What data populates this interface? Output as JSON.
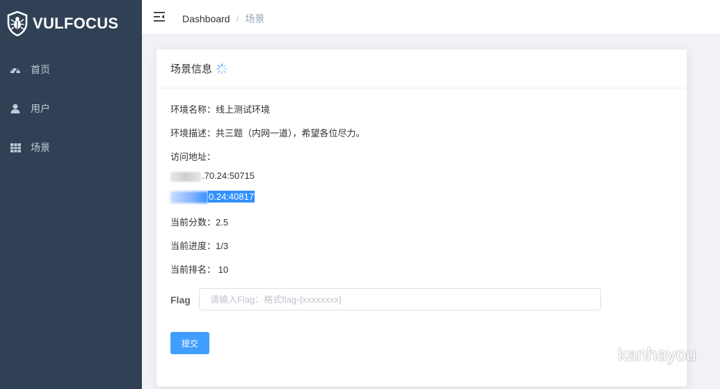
{
  "app": {
    "brand": "VULFOCUS"
  },
  "sidebar": {
    "items": [
      {
        "label": "首页",
        "icon": "dashboard-icon"
      },
      {
        "label": "用户",
        "icon": "user-icon"
      },
      {
        "label": "场景",
        "icon": "table-icon"
      }
    ]
  },
  "navbar": {
    "breadcrumb": [
      "Dashboard",
      "场景"
    ]
  },
  "card": {
    "title": "场景信息",
    "env_name": "环境名称：线上测试环境",
    "env_desc": "环境描述：共三题（内网一道），希望各位尽力。",
    "address_label": "访问地址：",
    "address_1": ".70.24:50715",
    "address_2": "0.24:40817",
    "score": "当前分数：2.5",
    "progress": "当前进度：1/3",
    "rank": "当前排名： 10"
  },
  "form": {
    "flag_label": "Flag",
    "flag_value": "",
    "flag_placeholder": "请输入Flag：格式flag-{xxxxxxxx}",
    "submit_label": "提交"
  },
  "watermark": {
    "text": "kanhayou"
  },
  "colors": {
    "sidebar_bg": "#304156",
    "sidebar_text": "#bfcbd9",
    "primary": "#409eff",
    "selection": "#3390ff"
  }
}
